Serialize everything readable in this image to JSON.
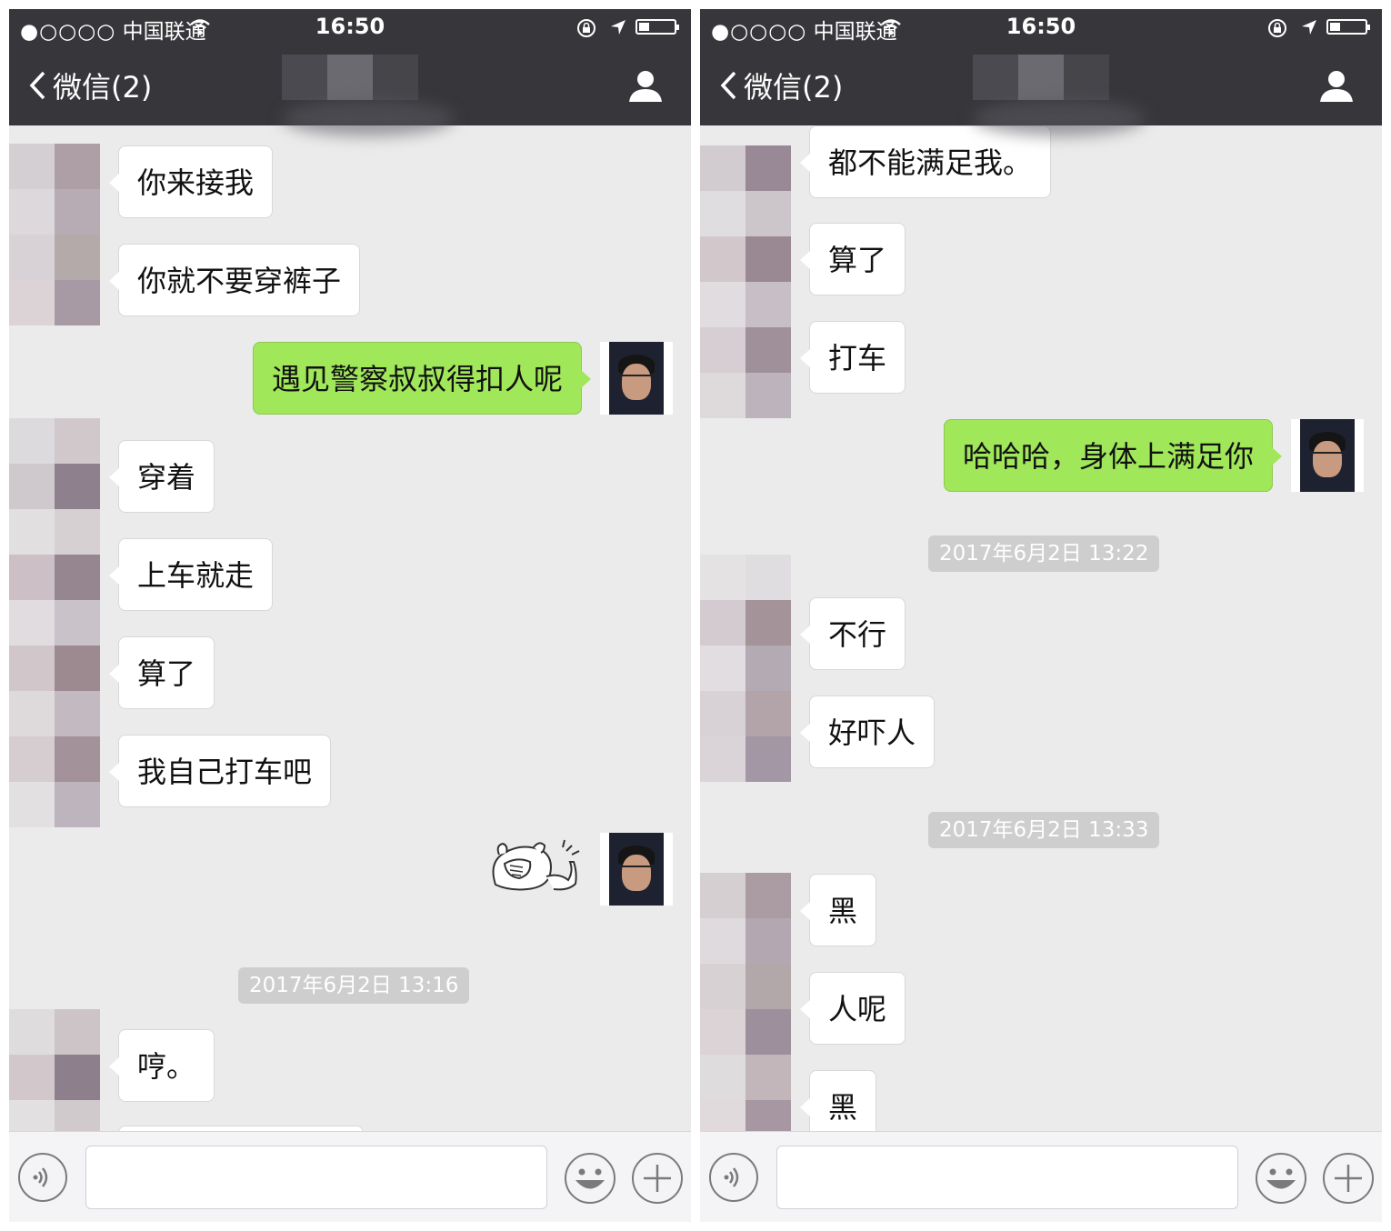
{
  "status_bar": {
    "signal": "●○○○○",
    "carrier": "中国联通",
    "time": "16:50"
  },
  "nav": {
    "back_label": "微信(2)"
  },
  "colors": {
    "nav_bg": "#37373b",
    "chat_bg": "#ebebeb",
    "outgoing_bubble": "#a0e75a",
    "incoming_bubble": "#ffffff"
  },
  "left_screen": {
    "messages": [
      {
        "side": "in",
        "text": "你来接我"
      },
      {
        "side": "in",
        "text": "你就不要穿裤子"
      },
      {
        "side": "out",
        "text": "遇见警察叔叔得扣人呢"
      },
      {
        "side": "in",
        "text": "穿着"
      },
      {
        "side": "in",
        "text": "上车就走"
      },
      {
        "side": "in",
        "text": "算了"
      },
      {
        "side": "in",
        "text": "我自己打车吧"
      },
      {
        "side": "out",
        "sticker": "facepalm-sticker"
      },
      {
        "timestamp": "2017年6月2日 13:16"
      },
      {
        "side": "in",
        "text": "哼。"
      }
    ]
  },
  "right_screen": {
    "messages": [
      {
        "side": "in",
        "text": "都不能满足我。"
      },
      {
        "side": "in",
        "text": "算了"
      },
      {
        "side": "in",
        "text": "打车"
      },
      {
        "side": "out",
        "text": "哈哈哈，身体上满足你"
      },
      {
        "timestamp": "2017年6月2日 13:22"
      },
      {
        "side": "in",
        "text": "不行"
      },
      {
        "side": "in",
        "text": "好吓人"
      },
      {
        "timestamp": "2017年6月2日 13:33"
      },
      {
        "side": "in",
        "text": "黑"
      },
      {
        "side": "in",
        "text": "人呢"
      },
      {
        "side": "in",
        "text": "黑"
      }
    ]
  },
  "input_bar": {
    "icons": [
      "voice-icon",
      "emoji-icon",
      "plus-icon"
    ],
    "value": ""
  }
}
